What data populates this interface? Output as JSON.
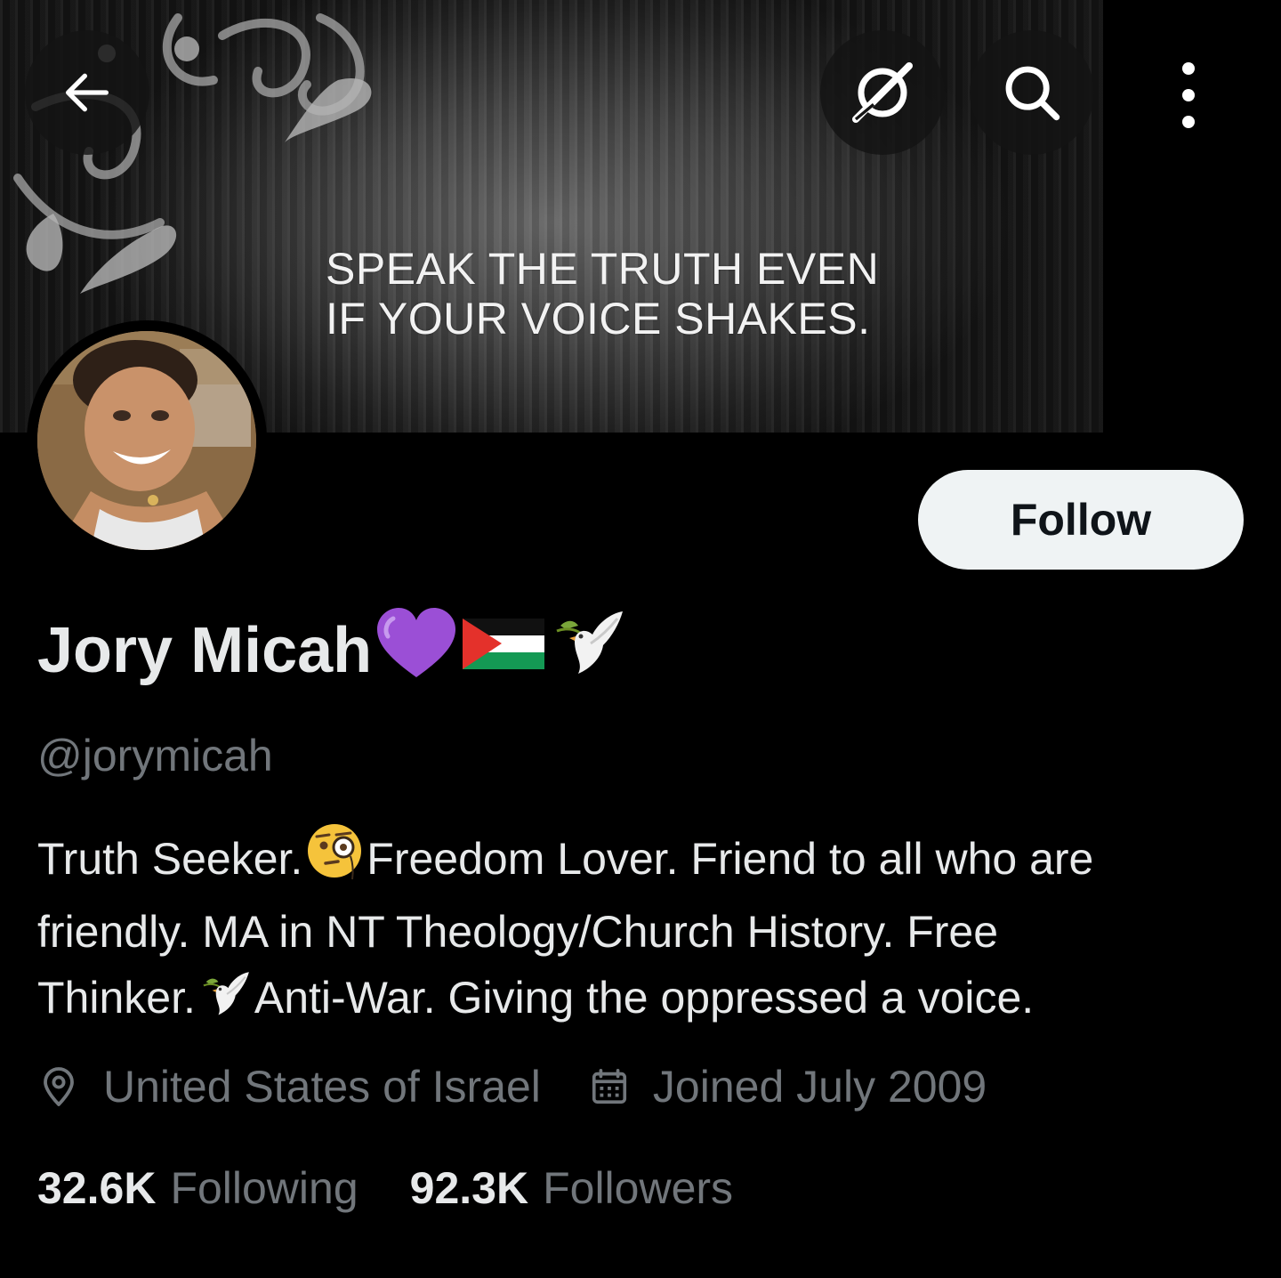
{
  "banner": {
    "quote_line1": "SPEAK THE TRUTH EVEN",
    "quote_line2": "IF YOUR VOICE SHAKES."
  },
  "nav": {
    "back_icon": "arrow-left-icon",
    "grok_icon": "grok-icon",
    "search_icon": "search-icon",
    "more_icon": "more-vertical-icon"
  },
  "profile": {
    "display_name": "Jory Micah",
    "name_emojis": [
      "purple-heart",
      "palestine-flag",
      "dove"
    ],
    "handle": "@jorymicah",
    "follow_label": "Follow",
    "bio": {
      "line1_a": "Truth Seeker.",
      "line1_b": "Freedom Lover. Friend to all who are",
      "line2": "friendly. MA in NT Theology/Church History. Free",
      "line3_a": "Thinker.",
      "line3_b": "Anti-War. Giving the oppressed a voice."
    },
    "location": "United States of Israel",
    "joined": "Joined July 2009",
    "following_count": "32.6K",
    "following_label": "Following",
    "followers_count": "92.3K",
    "followers_label": "Followers"
  },
  "colors": {
    "background": "#000000",
    "primary_text": "#e7e9ea",
    "secondary_text": "#71767b",
    "follow_bg": "#eff3f4",
    "follow_text": "#0f1419",
    "heart": "#9b4fd6",
    "flag_green": "#149954",
    "flag_red": "#e4312b"
  }
}
